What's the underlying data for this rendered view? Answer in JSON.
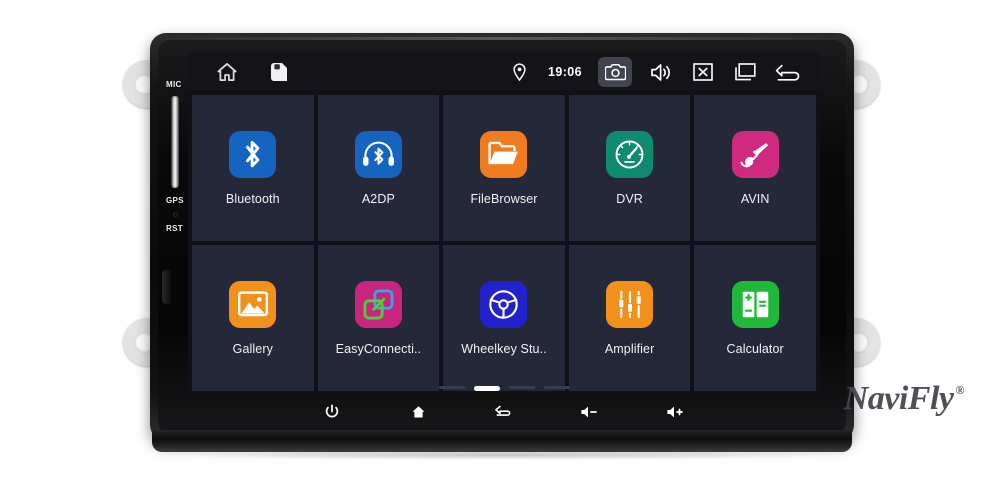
{
  "device": {
    "brand": "NaviFly",
    "brand_mark": "®",
    "side_labels": {
      "mic": "MIC",
      "gps": "GPS",
      "reset": "RST"
    }
  },
  "statusbar": {
    "home_icon": "home-icon",
    "storage_icon": "sd-card-icon",
    "location_icon": "location-pin-icon",
    "clock": "19:06",
    "camera_icon": "camera-icon",
    "volume_icon": "speaker-icon",
    "close_icon": "close-box-icon",
    "recents_icon": "recent-apps-icon",
    "back_icon": "back-arrow-icon",
    "highlight_color": "#41434f",
    "background": "#141418"
  },
  "apps": [
    {
      "label": "Bluetooth",
      "icon": "bluetooth-icon",
      "color": "#1565c0"
    },
    {
      "label": "A2DP",
      "icon": "headphones-icon",
      "color": "#1565c0"
    },
    {
      "label": "FileBrowser",
      "icon": "folder-open-icon",
      "color": "#f07c1f"
    },
    {
      "label": "DVR",
      "icon": "speedometer-icon",
      "color": "#0e8a6e"
    },
    {
      "label": "AVIN",
      "icon": "audio-jack-icon",
      "color": "#cf2a80"
    },
    {
      "label": "Gallery",
      "icon": "photo-icon",
      "color": "#f2901c"
    },
    {
      "label": "EasyConnecti..",
      "icon": "easyconnect-icon",
      "color": "#c9257f"
    },
    {
      "label": "Wheelkey Stu..",
      "icon": "steering-wheel-icon",
      "color": "#2222cc"
    },
    {
      "label": "Amplifier",
      "icon": "equalizer-icon",
      "color": "#f2901c"
    },
    {
      "label": "Calculator",
      "icon": "calculator-icon",
      "color": "#1fb838"
    }
  ],
  "pager": {
    "pages": 4,
    "active_index": 1
  },
  "hardware_keys": [
    {
      "name": "power-key",
      "icon": "power-icon"
    },
    {
      "name": "home-key",
      "icon": "home-icon"
    },
    {
      "name": "back-key",
      "icon": "back-arrow-icon"
    },
    {
      "name": "volume-down-key",
      "icon": "volume-down-icon"
    },
    {
      "name": "volume-up-key",
      "icon": "volume-up-icon"
    }
  ],
  "theme": {
    "screen_background": "#101019",
    "tile_background": "#242838",
    "text_color": "#f2f2f5"
  }
}
